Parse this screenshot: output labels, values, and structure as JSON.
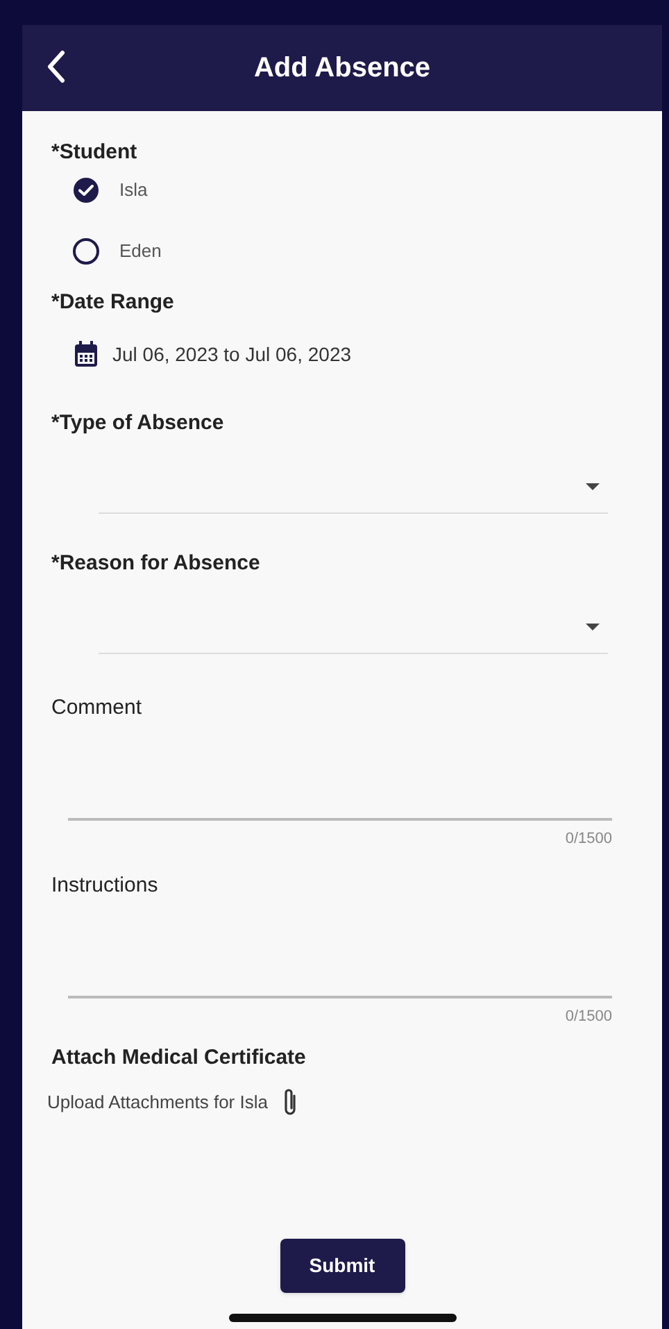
{
  "header": {
    "title": "Add Absence"
  },
  "student": {
    "label": "*Student",
    "options": [
      {
        "name": "Isla",
        "selected": true
      },
      {
        "name": "Eden",
        "selected": false
      }
    ]
  },
  "date_range": {
    "label": "*Date Range",
    "value": "Jul 06, 2023 to Jul 06, 2023"
  },
  "dropdowns": [
    {
      "label": "*Type of Absence"
    },
    {
      "label": "*Reason for Absence"
    }
  ],
  "text_areas": [
    {
      "label": "Comment",
      "counter": "0/1500"
    },
    {
      "label": "Instructions",
      "counter": "0/1500"
    }
  ],
  "attachment": {
    "label": "Attach Medical Certificate",
    "link": "Upload Attachments for Isla"
  },
  "submit": "Submit"
}
